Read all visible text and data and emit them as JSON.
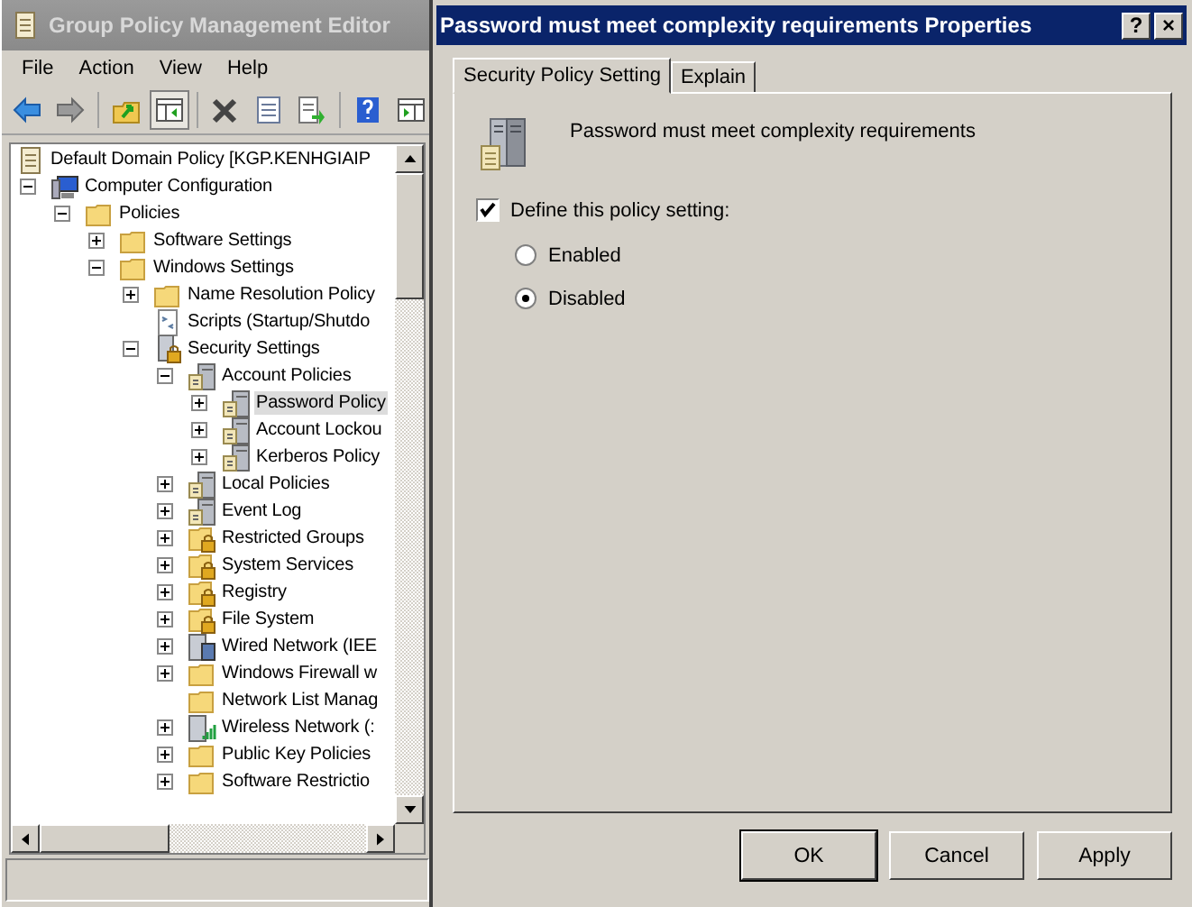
{
  "main_window": {
    "title": "Group Policy Management Editor",
    "menu": [
      "File",
      "Action",
      "View",
      "Help"
    ],
    "tree": [
      {
        "label": "Default Domain Policy [KGP.KENHGIAIP",
        "kind": "policy",
        "selected": false,
        "children": [
          {
            "label": "Computer Configuration",
            "kind": "computer",
            "expanded": true,
            "selected": false,
            "children": [
              {
                "label": "Policies",
                "kind": "folder",
                "expanded": true,
                "selected": false,
                "children": [
                  {
                    "label": "Software Settings",
                    "kind": "folder",
                    "expanded": false,
                    "selected": false
                  },
                  {
                    "label": "Windows Settings",
                    "kind": "folder",
                    "expanded": true,
                    "selected": false,
                    "children": [
                      {
                        "label": "Name Resolution Policy",
                        "kind": "folder",
                        "expanded": false,
                        "selected": false
                      },
                      {
                        "label": "Scripts (Startup/Shutdo",
                        "kind": "script",
                        "selected": false
                      },
                      {
                        "label": "Security Settings",
                        "kind": "security",
                        "expanded": true,
                        "selected": false,
                        "children": [
                          {
                            "label": "Account Policies",
                            "kind": "server",
                            "expanded": true,
                            "selected": false,
                            "children": [
                              {
                                "label": "Password Policy",
                                "kind": "server",
                                "expanded": false,
                                "selected": true
                              },
                              {
                                "label": "Account Lockou",
                                "kind": "server",
                                "expanded": false,
                                "selected": false
                              },
                              {
                                "label": "Kerberos Policy",
                                "kind": "server",
                                "expanded": false,
                                "selected": false
                              }
                            ]
                          },
                          {
                            "label": "Local Policies",
                            "kind": "server",
                            "expanded": false,
                            "selected": false
                          },
                          {
                            "label": "Event Log",
                            "kind": "server",
                            "expanded": false,
                            "selected": false
                          },
                          {
                            "label": "Restricted Groups",
                            "kind": "locked",
                            "expanded": false,
                            "selected": false
                          },
                          {
                            "label": "System Services",
                            "kind": "locked",
                            "expanded": false,
                            "selected": false
                          },
                          {
                            "label": "Registry",
                            "kind": "locked",
                            "expanded": false,
                            "selected": false
                          },
                          {
                            "label": "File System",
                            "kind": "locked",
                            "expanded": false,
                            "selected": false
                          },
                          {
                            "label": "Wired Network (IEE",
                            "kind": "wired",
                            "expanded": false,
                            "selected": false
                          },
                          {
                            "label": "Windows Firewall w",
                            "kind": "folder",
                            "expanded": false,
                            "selected": false
                          },
                          {
                            "label": "Network List Manag",
                            "kind": "folder",
                            "selected": false
                          },
                          {
                            "label": "Wireless Network (:",
                            "kind": "wireless",
                            "expanded": false,
                            "selected": false
                          },
                          {
                            "label": "Public Key Policies",
                            "kind": "folder",
                            "expanded": false,
                            "selected": false
                          },
                          {
                            "label": "Software Restrictio",
                            "kind": "folder",
                            "expanded": false,
                            "selected": false
                          }
                        ]
                      }
                    ]
                  }
                ]
              }
            ]
          }
        ]
      }
    ]
  },
  "dialog": {
    "title": "Password must meet complexity requirements Properties",
    "title_buttons": [
      "?",
      "×"
    ],
    "tabs": [
      {
        "label": "Security Policy Setting",
        "selected": true
      },
      {
        "label": "Explain",
        "selected": false
      }
    ],
    "policy_name": "Password must meet complexity requirements",
    "define_setting": {
      "label": "Define this policy setting:",
      "checked": true
    },
    "options": [
      {
        "label": "Enabled",
        "selected": false
      },
      {
        "label": "Disabled",
        "selected": true
      }
    ],
    "buttons": [
      {
        "label": "OK",
        "default": true
      },
      {
        "label": "Cancel",
        "default": false
      },
      {
        "label": "Apply",
        "default": false
      }
    ]
  }
}
